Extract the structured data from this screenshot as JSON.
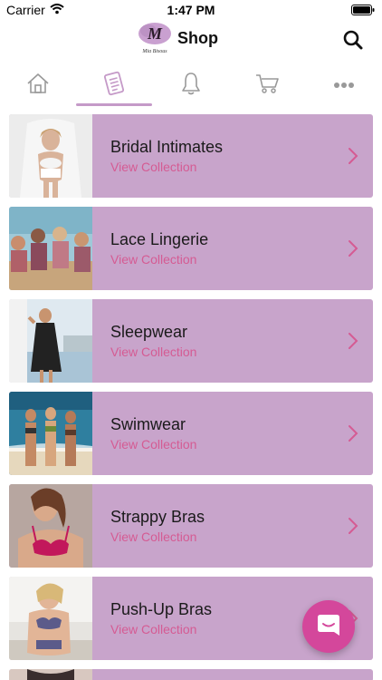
{
  "status": {
    "carrier": "Carrier",
    "time": "1:47 PM"
  },
  "header": {
    "title": "Shop",
    "logo_letter": "M",
    "logo_caption": "Mia Bisous"
  },
  "tabs": [
    {
      "icon": "home-icon"
    },
    {
      "icon": "catalog-icon",
      "active": true
    },
    {
      "icon": "bell-icon"
    },
    {
      "icon": "cart-icon"
    },
    {
      "icon": "more-icon"
    }
  ],
  "collections": [
    {
      "title": "Bridal Intimates",
      "subtitle": "View Collection"
    },
    {
      "title": "Lace Lingerie",
      "subtitle": "View Collection"
    },
    {
      "title": "Sleepwear",
      "subtitle": "View Collection"
    },
    {
      "title": "Swimwear",
      "subtitle": "View Collection"
    },
    {
      "title": "Strappy Bras",
      "subtitle": "View Collection"
    },
    {
      "title": "Push-Up Bras",
      "subtitle": "View Collection"
    }
  ],
  "colors": {
    "card_bg": "#c8a4cb",
    "accent": "#d55b93",
    "fab": "#d4479b",
    "tab_indicator": "#c59ac8"
  }
}
